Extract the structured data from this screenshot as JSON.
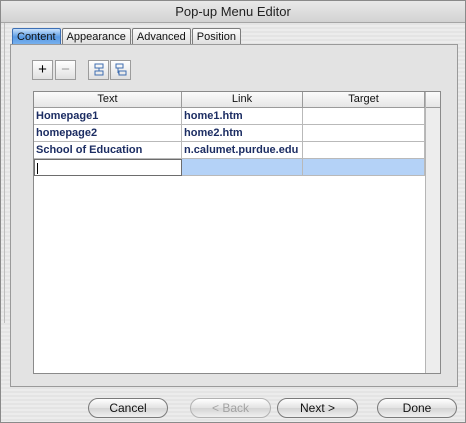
{
  "window": {
    "title": "Pop-up Menu Editor"
  },
  "tabs": [
    {
      "label": "Content",
      "active": true
    },
    {
      "label": "Appearance",
      "active": false
    },
    {
      "label": "Advanced",
      "active": false
    },
    {
      "label": "Position",
      "active": false
    }
  ],
  "toolbar": {
    "add_label": "+",
    "remove_label": "−",
    "indent_icon": "indent-icon",
    "outdent_icon": "outdent-icon"
  },
  "grid": {
    "columns": [
      "Text",
      "Link",
      "Target"
    ],
    "rows": [
      [
        "Homepage1",
        "home1.htm",
        ""
      ],
      [
        "homepage2",
        "home2.htm",
        ""
      ],
      [
        "School of Education",
        "n.calumet.purdue.edu",
        ""
      ],
      [
        "",
        "",
        ""
      ]
    ]
  },
  "buttons": {
    "cancel": "Cancel",
    "back": "< Back",
    "next": "Next >",
    "done": "Done"
  },
  "colors": {
    "active_tab": "#5a9be4",
    "selection": "#b4d2f7",
    "cell_text": "#1c2d63"
  }
}
